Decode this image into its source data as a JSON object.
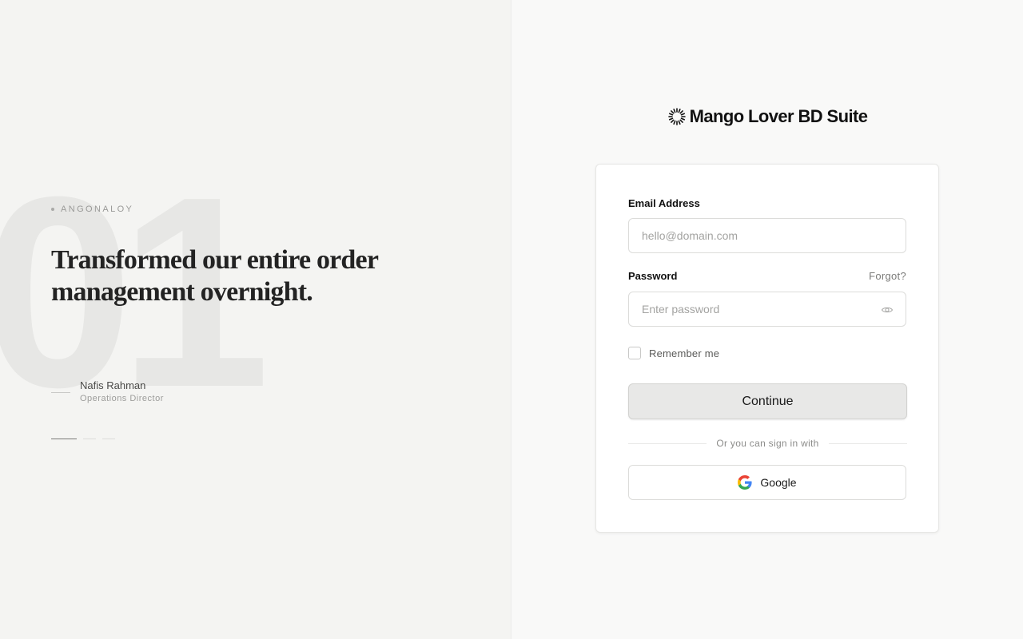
{
  "testimonial": {
    "number": "01",
    "eyebrow": "ANGONALOY",
    "quote": "Transformed our entire order management overnight.",
    "author_name": "Nafis Rahman",
    "author_role": "Operations Director",
    "pager": {
      "total": 3,
      "active_index": 0
    }
  },
  "brand": {
    "name": "Mango Lover BD Suite",
    "logo_icon": "sunburst-logo-icon"
  },
  "form": {
    "email_label": "Email Address",
    "email_placeholder": "hello@domain.com",
    "email_value": "",
    "password_label": "Password",
    "password_placeholder": "Enter password",
    "password_value": "",
    "forgot_label": "Forgot?",
    "remember_label": "Remember me",
    "remember_checked": false,
    "continue_label": "Continue",
    "divider_text": "Or you can sign in with",
    "google_label": "Google"
  },
  "colors": {
    "left_bg": "#f4f4f2",
    "right_bg": "#f9f9f8",
    "button_bg": "#e8e8e7"
  }
}
